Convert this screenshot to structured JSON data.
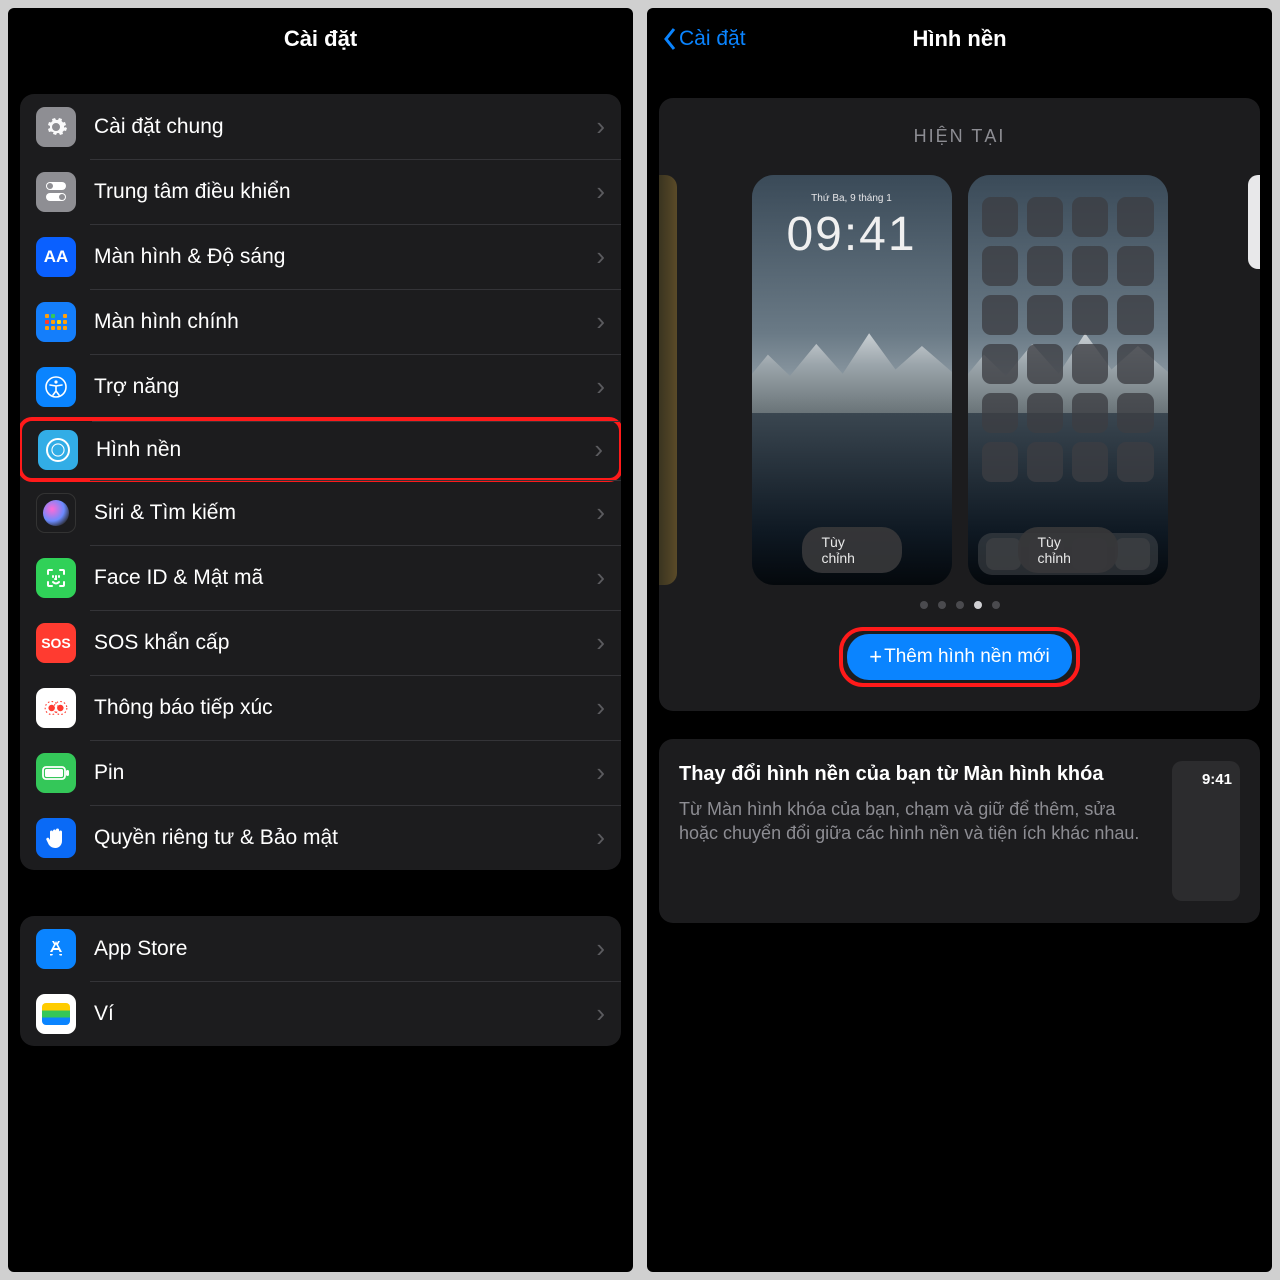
{
  "left": {
    "title": "Cài đặt",
    "items": [
      {
        "label": "Cài đặt chung",
        "icon": "gear",
        "bg": "ic-gray"
      },
      {
        "label": "Trung tâm điều khiển",
        "icon": "toggles",
        "bg": "ic-gray2"
      },
      {
        "label": "Màn hình & Độ sáng",
        "icon": "AA",
        "bg": "ic-blue"
      },
      {
        "label": "Màn hình chính",
        "icon": "grid",
        "bg": "ic-blue2"
      },
      {
        "label": "Trợ năng",
        "icon": "person",
        "bg": "ic-blue3"
      },
      {
        "label": "Hình nền",
        "icon": "flower",
        "bg": "ic-cyan",
        "highlight": true
      },
      {
        "label": "Siri & Tìm kiếm",
        "icon": "siri",
        "bg": "ic-dark"
      },
      {
        "label": "Face ID & Mật mã",
        "icon": "face",
        "bg": "ic-green"
      },
      {
        "label": "SOS khẩn cấp",
        "icon": "SOS",
        "bg": "ic-red"
      },
      {
        "label": "Thông báo tiếp xúc",
        "icon": "exposure",
        "bg": "ic-white"
      },
      {
        "label": "Pin",
        "icon": "battery",
        "bg": "ic-green2"
      },
      {
        "label": "Quyền riêng tư & Bảo mật",
        "icon": "hand",
        "bg": "ic-blue4"
      }
    ],
    "group2": [
      {
        "label": "App Store",
        "icon": "appstore",
        "bg": "ic-store"
      },
      {
        "label": "Ví",
        "icon": "wallet",
        "bg": "ic-wallet"
      }
    ]
  },
  "right": {
    "back": "Cài đặt",
    "title": "Hình nền",
    "section": "HIỆN TẠI",
    "lock": {
      "date": "Thứ Ba, 9 tháng 1",
      "time": "09:41"
    },
    "customize": "Tùy chỉnh",
    "dots_active": 3,
    "dots_total": 5,
    "add": "Thêm hình nền mới",
    "info": {
      "title": "Thay đổi hình nền của bạn từ Màn hình khóa",
      "body": "Từ Màn hình khóa của bạn, chạm và giữ để thêm, sửa hoặc chuyển đổi giữa các hình nền và tiện ích khác nhau.",
      "thumb_time": "9:41"
    }
  }
}
